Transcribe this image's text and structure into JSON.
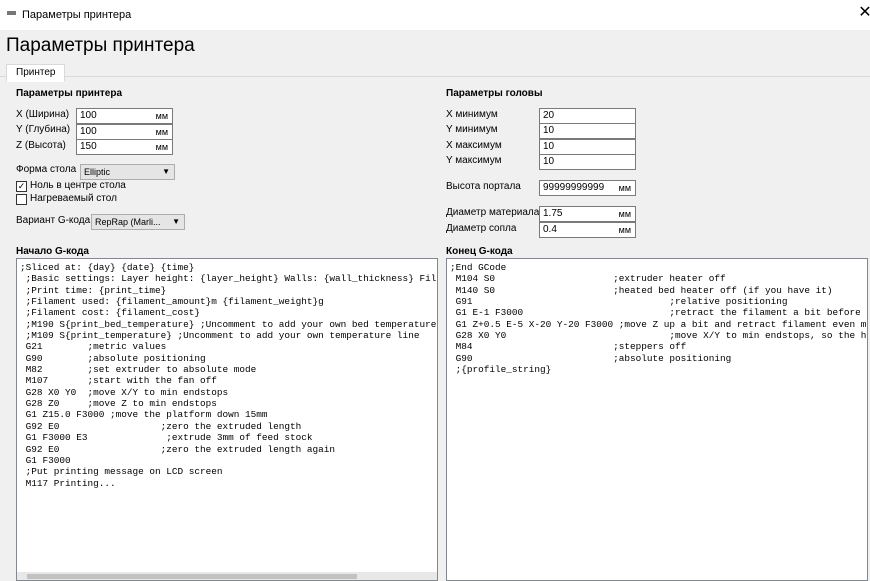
{
  "window": {
    "title": "Параметры принтера",
    "close_glyph": "✕"
  },
  "page_title": "Параметры принтера",
  "tabs": [
    {
      "label": "Принтер"
    }
  ],
  "printer_params": {
    "title": "Параметры принтера",
    "x_label": "X (Ширина)",
    "x_value": "100",
    "x_unit": "мм",
    "y_label": "Y (Глубина)",
    "y_value": "100",
    "y_unit": "мм",
    "z_label": "Z (Высота)",
    "z_value": "150",
    "z_unit": "мм",
    "bed_shape_label": "Форма стола",
    "bed_shape_value": "Elliptic",
    "zero_center_label": "Ноль в центре стола",
    "zero_center_checked": true,
    "heated_bed_label": "Нагреваемый стол",
    "heated_bed_checked": false,
    "gcode_flavor_label": "Вариант G-кода",
    "gcode_flavor_value": "RepRap (Marli..."
  },
  "head_params": {
    "title": "Параметры головы",
    "xmin_label": "X минимум",
    "xmin_value": "20",
    "ymin_label": "Y минимум",
    "ymin_value": "10",
    "xmax_label": "X максимум",
    "xmax_value": "10",
    "ymax_label": "Y максимум",
    "ymax_value": "10",
    "gantry_label": "Высота портала",
    "gantry_value": "99999999999",
    "gantry_unit": "мм",
    "material_diam_label": "Диаметр материала",
    "material_diam_value": "1.75",
    "material_diam_unit": "мм",
    "nozzle_diam_label": "Диаметр сопла",
    "nozzle_diam_value": "0.4",
    "nozzle_diam_unit": "мм"
  },
  "start_gcode": {
    "title": "Начало G-кода",
    "text": ";Sliced at: {day} {date} {time}\n ;Basic settings: Layer height: {layer_height} Walls: {wall_thickness} Fill: {f\n ;Print time: {print_time}\n ;Filament used: {filament_amount}m {filament_weight}g\n ;Filament cost: {filament_cost}\n ;M190 S{print_bed_temperature} ;Uncomment to add your own bed temperature line\n ;M109 S{print_temperature} ;Uncomment to add your own temperature line\n G21        ;metric values\n G90        ;absolute positioning\n M82        ;set extruder to absolute mode\n M107       ;start with the fan off\n G28 X0 Y0  ;move X/Y to min endstops\n G28 Z0     ;move Z to min endstops\n G1 Z15.0 F3000 ;move the platform down 15mm\n G92 E0                  ;zero the extruded length\n G1 F3000 E3              ;extrude 3mm of feed stock\n G92 E0                  ;zero the extruded length again\n G1 F3000\n ;Put printing message on LCD screen\n M117 Printing..."
  },
  "end_gcode": {
    "title": "Конец G-кода",
    "text": ";End GCode\n M104 S0                     ;extruder heater off\n M140 S0                     ;heated bed heater off (if you have it)\n G91                                   ;relative positioning\n G1 E-1 F3000                          ;retract the filament a bit before lif\n G1 Z+0.5 E-5 X-20 Y-20 F3000 ;move Z up a bit and retract filament even more\n G28 X0 Y0                             ;move X/Y to min endstops, so the head\n M84                         ;steppers off\n G90                         ;absolute positioning\n ;{profile_string}"
  }
}
